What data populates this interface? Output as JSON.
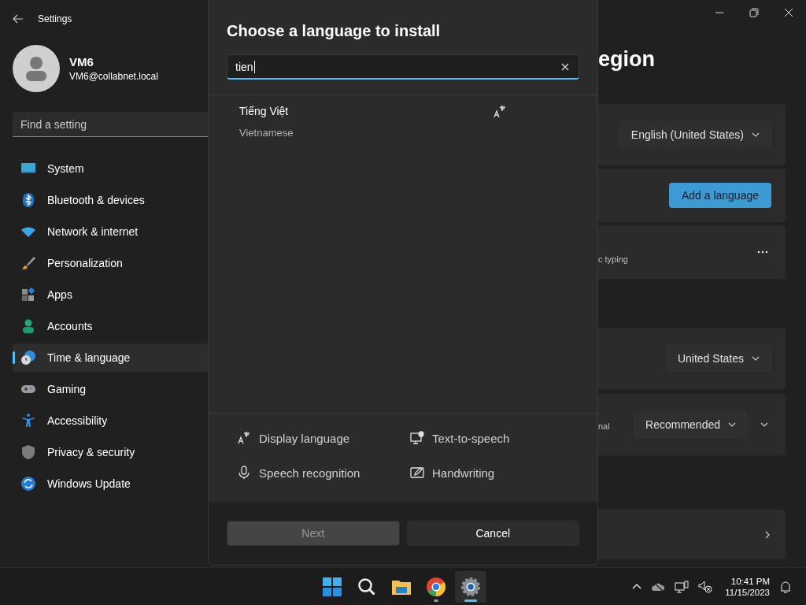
{
  "window": {
    "title": "Settings"
  },
  "user": {
    "name": "VM6",
    "email": "VM6@collabnet.local"
  },
  "search": {
    "placeholder": "Find a setting"
  },
  "nav": [
    {
      "kind": "system",
      "label": "System",
      "selected": false
    },
    {
      "kind": "bluetooth",
      "label": "Bluetooth & devices",
      "selected": false
    },
    {
      "kind": "network",
      "label": "Network & internet",
      "selected": false
    },
    {
      "kind": "personalization",
      "label": "Personalization",
      "selected": false
    },
    {
      "kind": "apps",
      "label": "Apps",
      "selected": false
    },
    {
      "kind": "accounts",
      "label": "Accounts",
      "selected": false
    },
    {
      "kind": "time",
      "label": "Time & language",
      "selected": true
    },
    {
      "kind": "gaming",
      "label": "Gaming",
      "selected": false
    },
    {
      "kind": "accessibility",
      "label": "Accessibility",
      "selected": false
    },
    {
      "kind": "privacy",
      "label": "Privacy & security",
      "selected": false
    },
    {
      "kind": "update",
      "label": "Windows Update",
      "selected": false
    }
  ],
  "page": {
    "heading": "egion",
    "cards": [
      {
        "kind": "dropdown",
        "value": "English (United States)"
      },
      {
        "kind": "button",
        "label": "Add a language"
      },
      {
        "kind": "more",
        "text": "c typing"
      },
      {
        "kind": "dropdown",
        "value": "United States"
      },
      {
        "kind": "dropdown_expand",
        "text": "nal",
        "value": "Recommended"
      },
      {
        "kind": "link"
      }
    ]
  },
  "dialog": {
    "title": "Choose a language to install",
    "search": {
      "value": "tien"
    },
    "results": [
      {
        "name": "Tiếng Việt",
        "english": "Vietnamese"
      }
    ],
    "features": [
      {
        "kind": "display",
        "label": "Display language"
      },
      {
        "kind": "tts",
        "label": "Text-to-speech"
      },
      {
        "kind": "speech",
        "label": "Speech recognition"
      },
      {
        "kind": "handwriting",
        "label": "Handwriting"
      }
    ],
    "buttons": [
      {
        "label": "Next",
        "disabled": true
      },
      {
        "label": "Cancel",
        "disabled": false
      }
    ]
  },
  "taskbar": {
    "apps": [
      {
        "kind": "start",
        "running": false,
        "active": false
      },
      {
        "kind": "search",
        "running": false,
        "active": false
      },
      {
        "kind": "explorer",
        "running": false,
        "active": false
      },
      {
        "kind": "chrome",
        "running": true,
        "active": false
      },
      {
        "kind": "settings",
        "running": true,
        "active": true
      }
    ],
    "time": "10:41 PM",
    "date": "11/15/2023"
  }
}
